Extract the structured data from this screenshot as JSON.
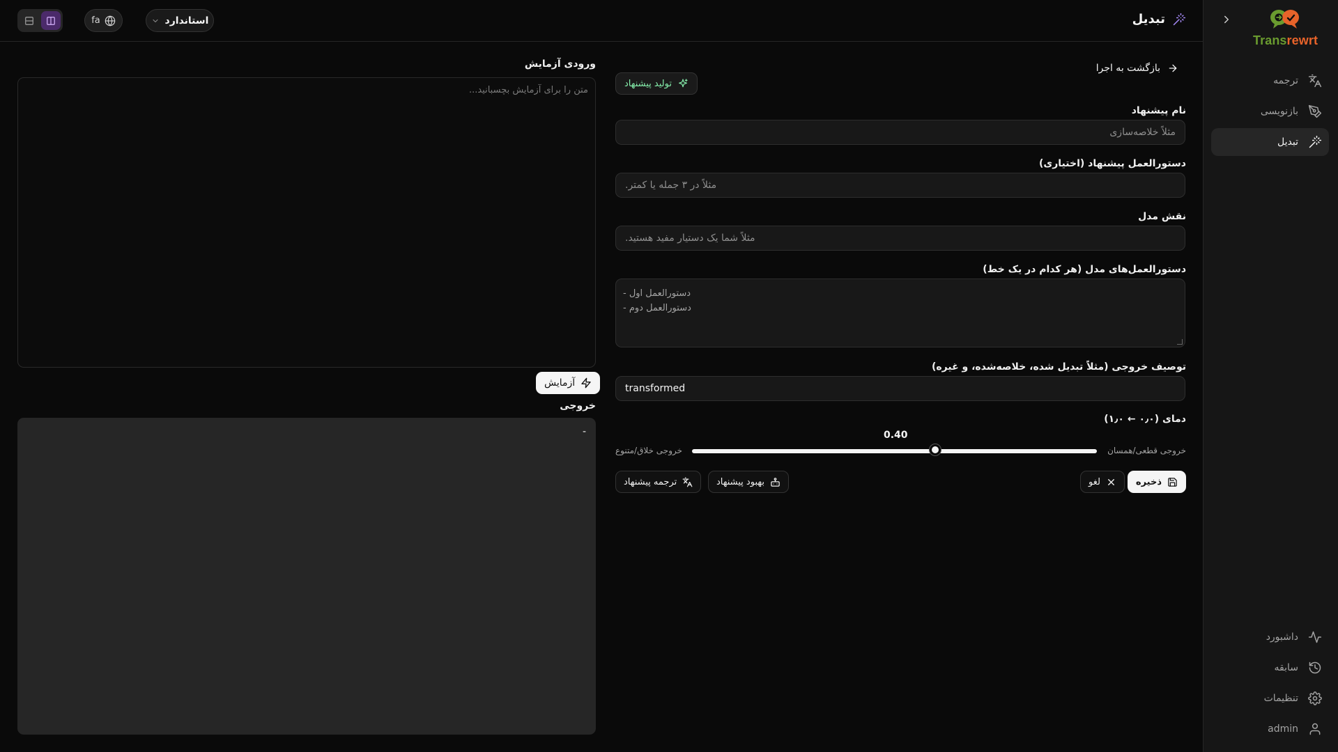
{
  "app": {
    "brand_left": "Trans",
    "brand_right": "rewrt"
  },
  "sidebar": {
    "nav_top": [
      {
        "label": "ترجمه",
        "icon": "translate-icon"
      },
      {
        "label": "بازنویسی",
        "icon": "pen-icon"
      },
      {
        "label": "تبدیل",
        "icon": "magic-wand-icon",
        "active": true
      }
    ],
    "nav_bottom": [
      {
        "label": "داشبورد",
        "icon": "activity-icon"
      },
      {
        "label": "سابقه",
        "icon": "history-icon"
      },
      {
        "label": "تنظیمات",
        "icon": "gear-icon"
      },
      {
        "label": "admin",
        "icon": "user-icon"
      }
    ]
  },
  "header": {
    "title": "تبدیل",
    "mode_select": "استاندارد",
    "language": "fa"
  },
  "form": {
    "back_label": "بازگشت به اجرا",
    "generate_label": "تولید پیشنهاد",
    "name_label": "نام پیشنهاد",
    "name_placeholder": "مثلاً خلاصه‌سازی",
    "instruction_label": "دستورالعمل پیشنهاد (اختیاری)",
    "instruction_placeholder": "مثلاً در ۳ جمله یا کمتر.",
    "role_label": "نقش مدل",
    "role_placeholder": "مثلاً شما یک دستیار مفید هستید.",
    "guidelines_label": "دستورالعمل‌های مدل (هر کدام در یک خط)",
    "guidelines_placeholder_line1": "- دستورالعمل اول",
    "guidelines_placeholder_line2": "- دستورالعمل دوم",
    "output_desc_label": "توصیف خروجی (مثلاً تبدیل شده، خلاصه‌شده، و غیره)",
    "output_desc_value": "transformed",
    "temperature_label": "دمای (۰٫۰ ← ۱٫۰)",
    "temperature_value": "0.40",
    "temperature": 0.4,
    "slider_left_label": "خروجی خلاق/متنوع",
    "slider_right_label": "خروجی قطعی/همسان",
    "save_label": "ذخیره",
    "cancel_label": "لغو",
    "improve_label": "بهبود پیشنهاد",
    "translate_label": "ترجمه پیشنهاد"
  },
  "test": {
    "input_label": "ورودی آزمایش",
    "input_placeholder": "متن را برای آزمایش بچسبانید...",
    "run_label": "آزمایش",
    "output_label": "خروجی",
    "output_value": "-"
  },
  "colors": {
    "brand_green": "#6a9b2f",
    "brand_orange": "#e8632a",
    "accent_purple": "#a78bfa",
    "generate_green": "#86efac"
  }
}
